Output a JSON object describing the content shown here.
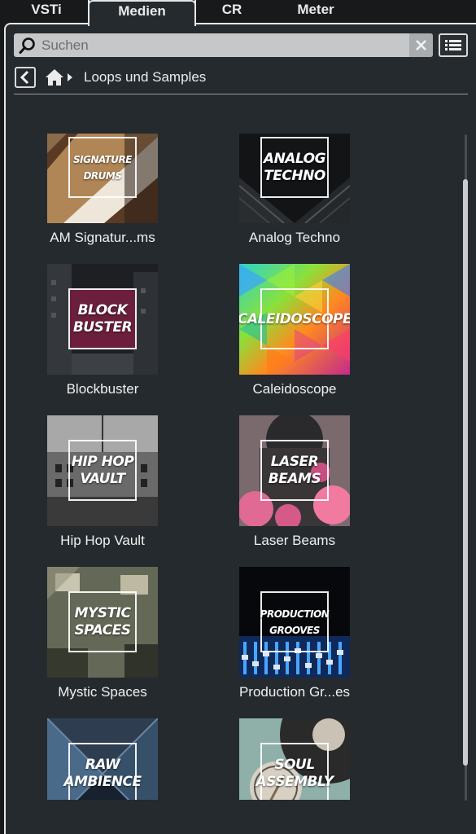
{
  "tabs": [
    {
      "label": "VSTi",
      "active": false
    },
    {
      "label": "Medien",
      "active": true
    },
    {
      "label": "CR",
      "active": false
    },
    {
      "label": "Meter",
      "active": false
    }
  ],
  "search": {
    "placeholder": "Suchen",
    "value": ""
  },
  "icons": {
    "search": "search-icon",
    "clear": "close-icon",
    "view": "list-view-icon",
    "back": "chevron-left-icon",
    "home": "home-icon",
    "crumb": "triangle-right-icon"
  },
  "breadcrumb": {
    "label": "Loops und Samples"
  },
  "items": [
    {
      "caption": "AM Signatur...ms",
      "cover_text": "SIGNATURE\nDRUMS",
      "theme": "signature"
    },
    {
      "caption": "Analog Techno",
      "cover_text": "ANALOG\nTECHNO",
      "theme": "techno"
    },
    {
      "caption": "Blockbuster",
      "cover_text": "BLOCK\nBUSTER",
      "theme": "blockbuster"
    },
    {
      "caption": "Caleidoscope",
      "cover_text": "CALEIDOSCOPE",
      "theme": "caleido"
    },
    {
      "caption": "Hip Hop Vault",
      "cover_text": "HIP HOP\nVAULT",
      "theme": "hiphop"
    },
    {
      "caption": "Laser Beams",
      "cover_text": "LASER\nBEAMS",
      "theme": "laser"
    },
    {
      "caption": "Mystic Spaces",
      "cover_text": "MYSTIC\nSPACES",
      "theme": "mystic"
    },
    {
      "caption": "Production Gr...es",
      "cover_text": "PRODUCTION\nGROOVES",
      "theme": "production"
    },
    {
      "caption": "",
      "cover_text": "RAW\nAMBIENCE",
      "theme": "raw"
    },
    {
      "caption": "",
      "cover_text": "SOUL\nASSEMBLY",
      "theme": "soul"
    }
  ],
  "colors": {
    "panel": "#252a2e",
    "background": "#17191b",
    "accent_text": "#e8e8e8",
    "search_bg": "#c5c7c9"
  }
}
